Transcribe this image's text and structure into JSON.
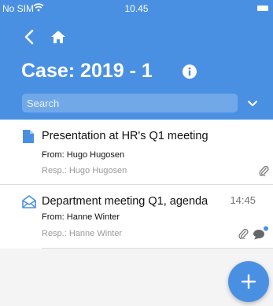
{
  "status_bar": {
    "carrier": "No SIM",
    "time": "10.45"
  },
  "header": {
    "title": "Case: 2019 - 1",
    "search": {
      "placeholder": "Search",
      "value": ""
    }
  },
  "items": [
    {
      "icon": "document-icon",
      "title": "Presentation at HR's Q1 meeting",
      "time": "",
      "from": "From: Hugo Hugosen",
      "resp": "Resp.: Hugo Hugosen",
      "attachment": true,
      "comment": false
    },
    {
      "icon": "open-envelope-icon",
      "title": "Department meeting Q1, agenda",
      "time": "14:45",
      "from": "From: Hanne Winter",
      "resp": "Resp.: Hanne Winter",
      "attachment": true,
      "comment": true
    }
  ],
  "colors": {
    "primary": "#4a90e2",
    "text": "#111111",
    "muted": "#999999"
  }
}
